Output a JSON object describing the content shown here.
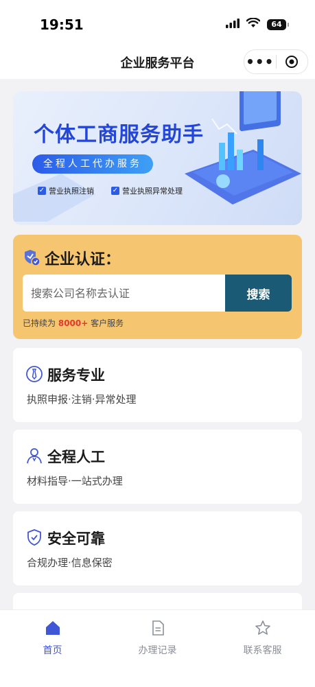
{
  "status_bar": {
    "time": "19:51",
    "battery": "64"
  },
  "nav": {
    "title": "企业服务平台",
    "more_icon": "more-dots-icon",
    "target_icon": "target-icon"
  },
  "banner": {
    "title": "个体工商服务助手",
    "pill": "全程人工代办服务",
    "checks": [
      "营业执照注销",
      "营业执照异常处理"
    ]
  },
  "auth": {
    "title": "企业认证：",
    "search_placeholder": "搜索公司名称去认证",
    "search_button": "搜索",
    "note_prefix": "已持续为",
    "note_count": "8000+",
    "note_suffix": "客户服务"
  },
  "features": [
    {
      "title": "服务专业",
      "subtitle": "执照申报·注销·异常处理",
      "icon": "tie-badge-icon"
    },
    {
      "title": "全程人工",
      "subtitle": "材料指导·一站式办理",
      "icon": "person-icon"
    },
    {
      "title": "安全可靠",
      "subtitle": "合规办理·信息保密",
      "icon": "shield-check-icon"
    }
  ],
  "tabbar": {
    "items": [
      {
        "label": "首页",
        "icon": "home-icon",
        "active": true
      },
      {
        "label": "办理记录",
        "icon": "document-icon",
        "active": false
      },
      {
        "label": "联系客服",
        "icon": "star-icon",
        "active": false
      }
    ]
  },
  "colors": {
    "primary": "#3f56d6",
    "auth_bg": "#f6c56f",
    "search_button": "#1a5a74",
    "highlight": "#e23a2e"
  }
}
